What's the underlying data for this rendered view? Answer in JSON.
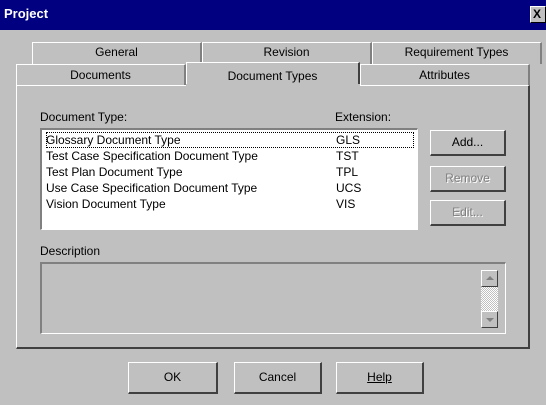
{
  "window": {
    "title": "Project",
    "close_glyph": "X"
  },
  "tabs": {
    "back_row": [
      {
        "label": "General",
        "mnemonic_index": 0
      },
      {
        "label": "Revision",
        "mnemonic_index": 2
      },
      {
        "label": "Requirement Types",
        "mnemonic_index": 1
      }
    ],
    "front_row": [
      {
        "label": "Documents",
        "mnemonic_index": 1
      },
      {
        "label": "Document Types",
        "mnemonic_index": 2,
        "active": true
      },
      {
        "label": "Attributes",
        "mnemonic_index": 5
      }
    ]
  },
  "doc_types": {
    "type_label": "Document Type:",
    "extension_label": "Extension:",
    "rows": [
      {
        "name": "Glossary Document Type",
        "ext": "GLS",
        "selected": true
      },
      {
        "name": "Test Case Specification Document Type",
        "ext": "TST"
      },
      {
        "name": "Test Plan Document Type",
        "ext": "TPL"
      },
      {
        "name": "Use Case Specification Document Type",
        "ext": "UCS"
      },
      {
        "name": "Vision Document Type",
        "ext": "VIS"
      }
    ]
  },
  "side_buttons": {
    "add": "Add...",
    "remove": "Remove",
    "edit": "Edit..."
  },
  "description": {
    "label": "Description",
    "text": ""
  },
  "footer": {
    "ok": "OK",
    "cancel": "Cancel",
    "help": "Help"
  }
}
